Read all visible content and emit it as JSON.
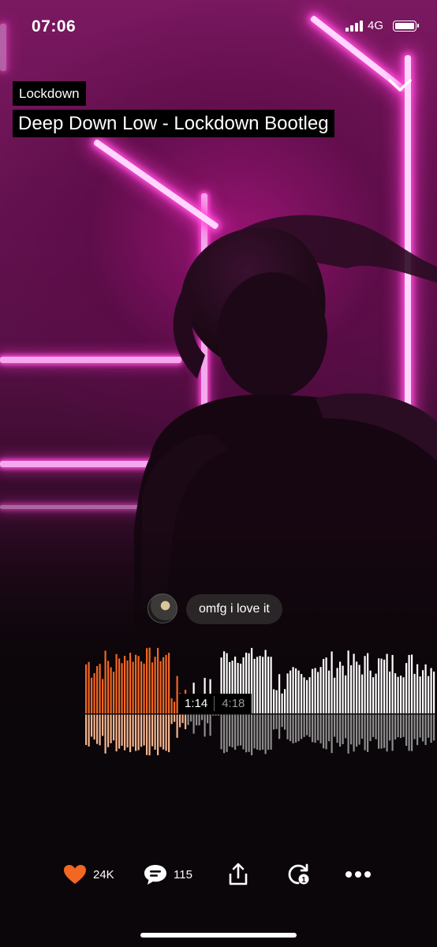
{
  "status_bar": {
    "time": "07:06",
    "network": "4G"
  },
  "track": {
    "artist": "Lockdown",
    "title": "Deep Down Low - Lockdown Bootleg"
  },
  "comment": {
    "text": "omfg i love it"
  },
  "player": {
    "current_time": "1:14",
    "total_time": "4:18",
    "progress": 0.287
  },
  "actions": {
    "likes": "24K",
    "comments": "115"
  },
  "colors": {
    "played": "#f26722",
    "played_reflection": "#f7b58e",
    "unplayed": "#ffffff",
    "unplayed_reflection": "#8d8d8d",
    "like": "#f26722"
  },
  "icons": [
    "signal-icon",
    "battery-icon",
    "chevron-down-icon",
    "heart-icon",
    "comment-icon",
    "share-icon",
    "repost-icon",
    "more-icon"
  ]
}
